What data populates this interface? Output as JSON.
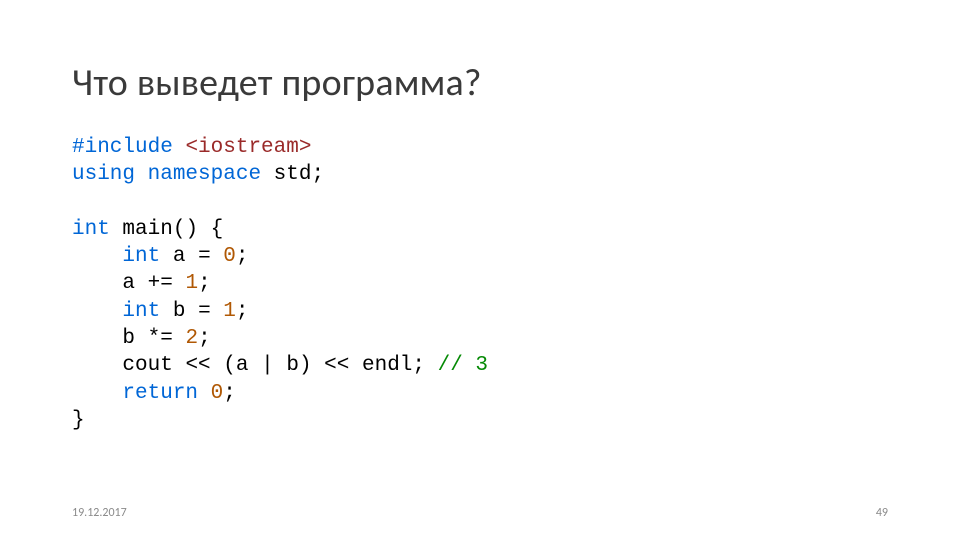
{
  "title": "Что выведет программа?",
  "code": {
    "include_directive": "#include",
    "include_header": "<iostream>",
    "using": "using",
    "namespace": "namespace",
    "std": "std",
    "semi": ";",
    "int": "int",
    "main": "main",
    "paren_open": "(",
    "paren_close": ")",
    "brace_open": "{",
    "brace_close": "}",
    "a": "a",
    "b": "b",
    "eq": "=",
    "pluseq": "+=",
    "stareq": "*=",
    "zero": "0",
    "one": "1",
    "two": "2",
    "cout": "cout",
    "ltlt": "<<",
    "pipe": "|",
    "endl": "endl",
    "return": "return",
    "comment": "// 3"
  },
  "footer": {
    "date": "19.12.2017",
    "page": "49"
  }
}
